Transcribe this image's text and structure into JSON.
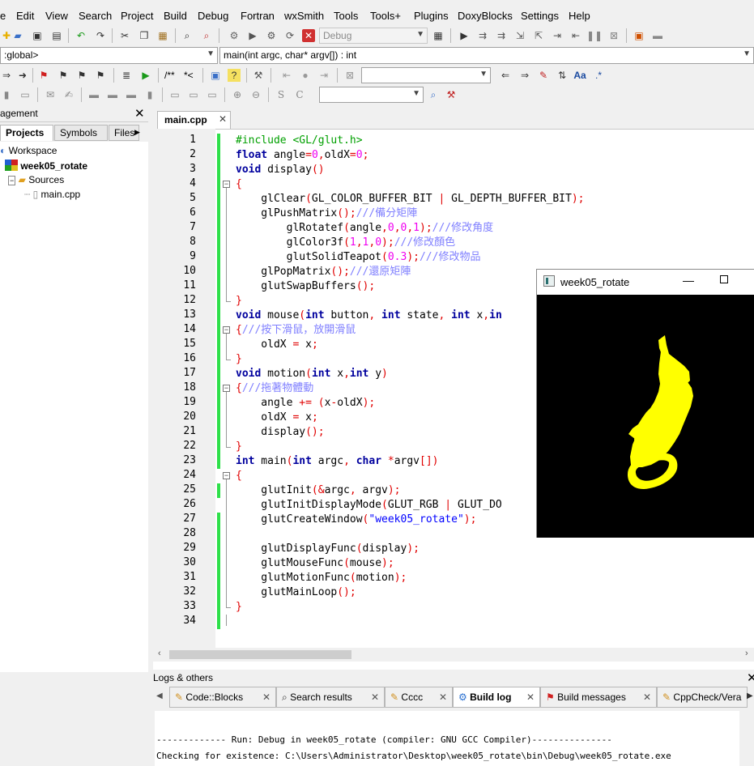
{
  "menubar": {
    "items": [
      "e",
      "Edit",
      "View",
      "Search",
      "Project",
      "Build",
      "Debug",
      "Fortran",
      "wxSmith",
      "Tools",
      "Tools+",
      "Plugins",
      "DoxyBlocks",
      "Settings",
      "Help"
    ]
  },
  "toolbar": {
    "build_target": "Debug",
    "scope_combo": "<global>",
    "scope_combo_visible": ":global>",
    "function_combo": "main(int argc, char* argv[]) : int",
    "doxy_comment": "/**",
    "doxy_inline": "*<",
    "search_combo": "",
    "symbol_combo": ""
  },
  "management": {
    "title": "agement",
    "tabs": [
      "Projects",
      "Symbols",
      "Files"
    ],
    "tree": {
      "workspace": "Workspace",
      "project": "week05_rotate",
      "folder": "Sources",
      "file": "main.cpp"
    }
  },
  "editor": {
    "tab_label": "main.cpp",
    "line_numbers": [
      "1",
      "2",
      "3",
      "4",
      "5",
      "6",
      "7",
      "8",
      "9",
      "10",
      "11",
      "12",
      "13",
      "14",
      "15",
      "16",
      "17",
      "18",
      "19",
      "20",
      "21",
      "22",
      "23",
      "24",
      "25",
      "26",
      "27",
      "28",
      "29",
      "30",
      "31",
      "32",
      "33",
      "34"
    ],
    "lines": [
      [
        [
          "pp",
          "#include <GL/glut.h>"
        ]
      ],
      [
        [
          "kw",
          "float"
        ],
        [
          "id",
          " angle"
        ],
        [
          "op",
          "="
        ],
        [
          "num",
          "0"
        ],
        [
          "op",
          ","
        ],
        [
          "id",
          "oldX"
        ],
        [
          "op",
          "="
        ],
        [
          "num",
          "0"
        ],
        [
          "op",
          ";"
        ]
      ],
      [
        [
          "kw",
          "void"
        ],
        [
          "id",
          " display"
        ],
        [
          "op",
          "()"
        ]
      ],
      [
        [
          "op",
          "{"
        ]
      ],
      [
        [
          "id",
          "    glClear"
        ],
        [
          "op",
          "("
        ],
        [
          "id",
          "GL_COLOR_BUFFER_BIT "
        ],
        [
          "op",
          "|"
        ],
        [
          "id",
          " GL_DEPTH_BUFFER_BIT"
        ],
        [
          "op",
          ");"
        ]
      ],
      [
        [
          "id",
          "    glPushMatrix"
        ],
        [
          "op",
          "();"
        ],
        [
          "cm",
          "///備分矩陣"
        ]
      ],
      [
        [
          "id",
          "        glRotatef"
        ],
        [
          "op",
          "("
        ],
        [
          "id",
          "angle"
        ],
        [
          "op",
          ","
        ],
        [
          "num",
          "0"
        ],
        [
          "op",
          ","
        ],
        [
          "num",
          "0"
        ],
        [
          "op",
          ","
        ],
        [
          "num",
          "1"
        ],
        [
          "op",
          ");"
        ],
        [
          "cm",
          "///修改角度"
        ]
      ],
      [
        [
          "id",
          "        glColor3f"
        ],
        [
          "op",
          "("
        ],
        [
          "num",
          "1"
        ],
        [
          "op",
          ","
        ],
        [
          "num",
          "1"
        ],
        [
          "op",
          ","
        ],
        [
          "num",
          "0"
        ],
        [
          "op",
          ");"
        ],
        [
          "cm",
          "///修改顏色"
        ]
      ],
      [
        [
          "id",
          "        glutSolidTeapot"
        ],
        [
          "op",
          "("
        ],
        [
          "num",
          "0.3"
        ],
        [
          "op",
          ");"
        ],
        [
          "cm",
          "///修改物品"
        ]
      ],
      [
        [
          "id",
          "    glPopMatrix"
        ],
        [
          "op",
          "();"
        ],
        [
          "cm",
          "///還原矩陣"
        ]
      ],
      [
        [
          "id",
          "    glutSwapBuffers"
        ],
        [
          "op",
          "();"
        ]
      ],
      [
        [
          "op",
          "}"
        ]
      ],
      [
        [
          "kw",
          "void"
        ],
        [
          "id",
          " mouse"
        ],
        [
          "op",
          "("
        ],
        [
          "kw",
          "int"
        ],
        [
          "id",
          " button"
        ],
        [
          "op",
          ","
        ],
        [
          "kw",
          " int"
        ],
        [
          "id",
          " state"
        ],
        [
          "op",
          ","
        ],
        [
          "kw",
          " int"
        ],
        [
          "id",
          " x"
        ],
        [
          "op",
          ","
        ],
        [
          "kw",
          "in"
        ]
      ],
      [
        [
          "op",
          "{"
        ],
        [
          "cm",
          "///按下滑鼠，放開滑鼠"
        ]
      ],
      [
        [
          "id",
          "    oldX "
        ],
        [
          "op",
          "="
        ],
        [
          "id",
          " x"
        ],
        [
          "op",
          ";"
        ]
      ],
      [
        [
          "op",
          "}"
        ]
      ],
      [
        [
          "kw",
          "void"
        ],
        [
          "id",
          " motion"
        ],
        [
          "op",
          "("
        ],
        [
          "kw",
          "int"
        ],
        [
          "id",
          " x"
        ],
        [
          "op",
          ","
        ],
        [
          "kw",
          "int"
        ],
        [
          "id",
          " y"
        ],
        [
          "op",
          ")"
        ]
      ],
      [
        [
          "op",
          "{"
        ],
        [
          "cm",
          "///拖著物體動"
        ]
      ],
      [
        [
          "id",
          "    angle "
        ],
        [
          "op",
          "+="
        ],
        [
          "id",
          " "
        ],
        [
          "op",
          "("
        ],
        [
          "id",
          "x"
        ],
        [
          "op",
          "-"
        ],
        [
          "id",
          "oldX"
        ],
        [
          "op",
          ");"
        ]
      ],
      [
        [
          "id",
          "    oldX "
        ],
        [
          "op",
          "="
        ],
        [
          "id",
          " x"
        ],
        [
          "op",
          ";"
        ]
      ],
      [
        [
          "id",
          "    display"
        ],
        [
          "op",
          "();"
        ]
      ],
      [
        [
          "op",
          "}"
        ]
      ],
      [
        [
          "kw",
          "int"
        ],
        [
          "id",
          " main"
        ],
        [
          "op",
          "("
        ],
        [
          "kw",
          "int"
        ],
        [
          "id",
          " argc"
        ],
        [
          "op",
          ","
        ],
        [
          "kw",
          " char"
        ],
        [
          "id",
          " "
        ],
        [
          "op",
          "*"
        ],
        [
          "id",
          "argv"
        ],
        [
          "op",
          "[])"
        ]
      ],
      [
        [
          "op",
          "{"
        ]
      ],
      [
        [
          "id",
          "    glutInit"
        ],
        [
          "op",
          "(&"
        ],
        [
          "id",
          "argc"
        ],
        [
          "op",
          ","
        ],
        [
          "id",
          " argv"
        ],
        [
          "op",
          ");"
        ]
      ],
      [
        [
          "id",
          "    glutInitDisplayMode"
        ],
        [
          "op",
          "("
        ],
        [
          "id",
          "GLUT_RGB "
        ],
        [
          "op",
          "|"
        ],
        [
          "id",
          " GLUT_DO"
        ]
      ],
      [
        [
          "id",
          "    glutCreateWindow"
        ],
        [
          "op",
          "("
        ],
        [
          "str",
          "\"week05_rotate\""
        ],
        [
          "op",
          ");"
        ]
      ],
      [
        [
          "id",
          ""
        ]
      ],
      [
        [
          "id",
          "    glutDisplayFunc"
        ],
        [
          "op",
          "("
        ],
        [
          "id",
          "display"
        ],
        [
          "op",
          ");"
        ]
      ],
      [
        [
          "id",
          "    glutMouseFunc"
        ],
        [
          "op",
          "("
        ],
        [
          "id",
          "mouse"
        ],
        [
          "op",
          ");"
        ]
      ],
      [
        [
          "id",
          "    glutMotionFunc"
        ],
        [
          "op",
          "("
        ],
        [
          "id",
          "motion"
        ],
        [
          "op",
          ");"
        ]
      ],
      [
        [
          "id",
          "    glutMainLoop"
        ],
        [
          "op",
          "();"
        ]
      ],
      [
        [
          "op",
          "}"
        ]
      ],
      [
        [
          "id",
          ""
        ]
      ]
    ]
  },
  "logs": {
    "title": "Logs & others",
    "tabs": [
      "Code::Blocks",
      "Search results",
      "Cccc",
      "Build log",
      "Build messages",
      "CppCheck/Vera"
    ],
    "active_tab": "Build log",
    "lines": [
      "------------- Run: Debug in week05_rotate (compiler: GNU GCC Compiler)---------------",
      "Checking for existence: C:\\Users\\Administrator\\Desktop\\week05_rotate\\bin\\Debug\\week05_rotate.exe"
    ]
  },
  "glut_window": {
    "title": "week05_rotate",
    "teapot_color": "#ffff00",
    "background": "#000000"
  },
  "colors": {
    "modified_marker": "#2ee04a",
    "keyword": "#00009e",
    "preprocessor": "#00a000",
    "number": "#f000f0",
    "comment": "#7f7fff",
    "operator": "#e00000"
  }
}
